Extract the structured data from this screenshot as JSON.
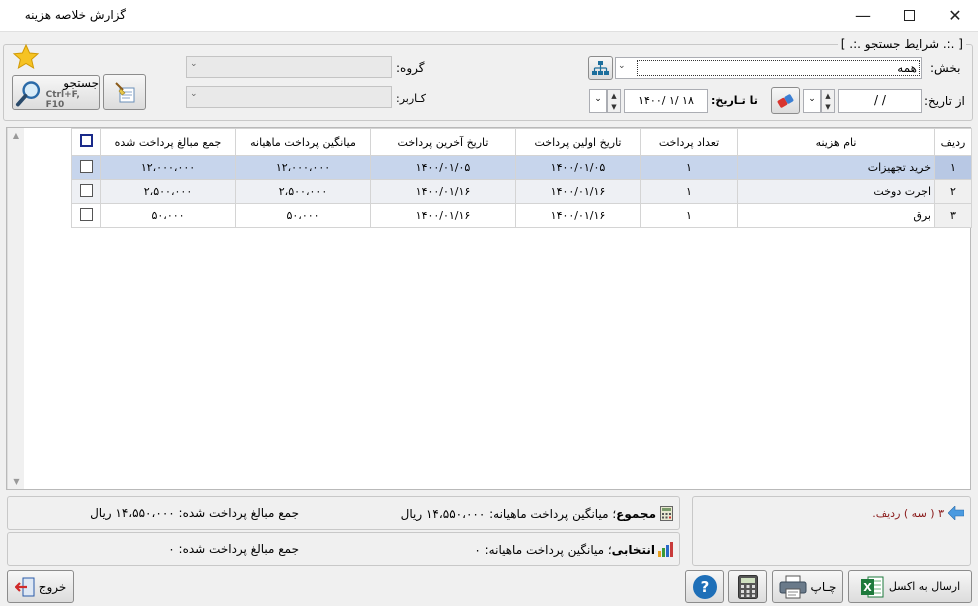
{
  "window": {
    "title": "گزارش خلاصه هزینه"
  },
  "search": {
    "group_title": "[ .:. شرایط جستجو .:. ]",
    "section_label": "بخش:",
    "section_value": "همه",
    "group_label": "گروه:",
    "user_label": "کـاربر:",
    "from_date_label": "از تاریخ:",
    "from_date_value": "/     /",
    "to_date_label": "تا تـاریخ:",
    "to_date_value": "۱۴۰۰/ ۱/ ۱۸",
    "search_button_label": "جستجو",
    "search_shortcut": "Ctrl+F, F10"
  },
  "table": {
    "columns": [
      "ردیف",
      "نام هزینه",
      "تعداد پرداخت",
      "تاریخ اولین پرداخت",
      "تاریخ آخرین پرداخت",
      "میانگین پرداخت ماهیانه",
      "جمع مبالغ پرداخت شده"
    ],
    "rows": [
      {
        "index": "۱",
        "name": "خرید تجهیزات",
        "count": "۱",
        "first": "۱۴۰۰/۰۱/۰۵",
        "last": "۱۴۰۰/۰۱/۰۵",
        "avg": "۱۲،۰۰۰،۰۰۰",
        "sum": "۱۲،۰۰۰،۰۰۰"
      },
      {
        "index": "۲",
        "name": "اجرت دوخت",
        "count": "۱",
        "first": "۱۴۰۰/۰۱/۱۶",
        "last": "۱۴۰۰/۰۱/۱۶",
        "avg": "۲،۵۰۰،۰۰۰",
        "sum": "۲،۵۰۰،۰۰۰"
      },
      {
        "index": "۳",
        "name": "برق",
        "count": "۱",
        "first": "۱۴۰۰/۰۱/۱۶",
        "last": "۱۴۰۰/۰۱/۱۶",
        "avg": "۵۰،۰۰۰",
        "sum": "۵۰،۰۰۰"
      }
    ]
  },
  "summary": {
    "row_count_text": "۳ ( سه ) ردیف.",
    "total_label": "مجموع",
    "total_avg_text": "؛ میانگین پرداخت ماهیانه: ۱۴،۵۵۰،۰۰۰ ریال",
    "total_sum_text": "جمع مبالغ پرداخت شده: ۱۴،۵۵۰،۰۰۰ ریال",
    "selected_label": "انتخابی",
    "selected_avg_text": "؛ میانگین پرداخت ماهیانه: ۰",
    "selected_sum_text": "جمع مبالغ پرداخت شده: ۰"
  },
  "footer": {
    "exit_label": "خروج",
    "excel_label": "ارسال به اکسل",
    "print_label": "چـاپ"
  },
  "colors": {
    "selected_row": "#c7d5ec",
    "excel_green": "#1e7a3c",
    "help_blue": "#1e6fb8"
  }
}
